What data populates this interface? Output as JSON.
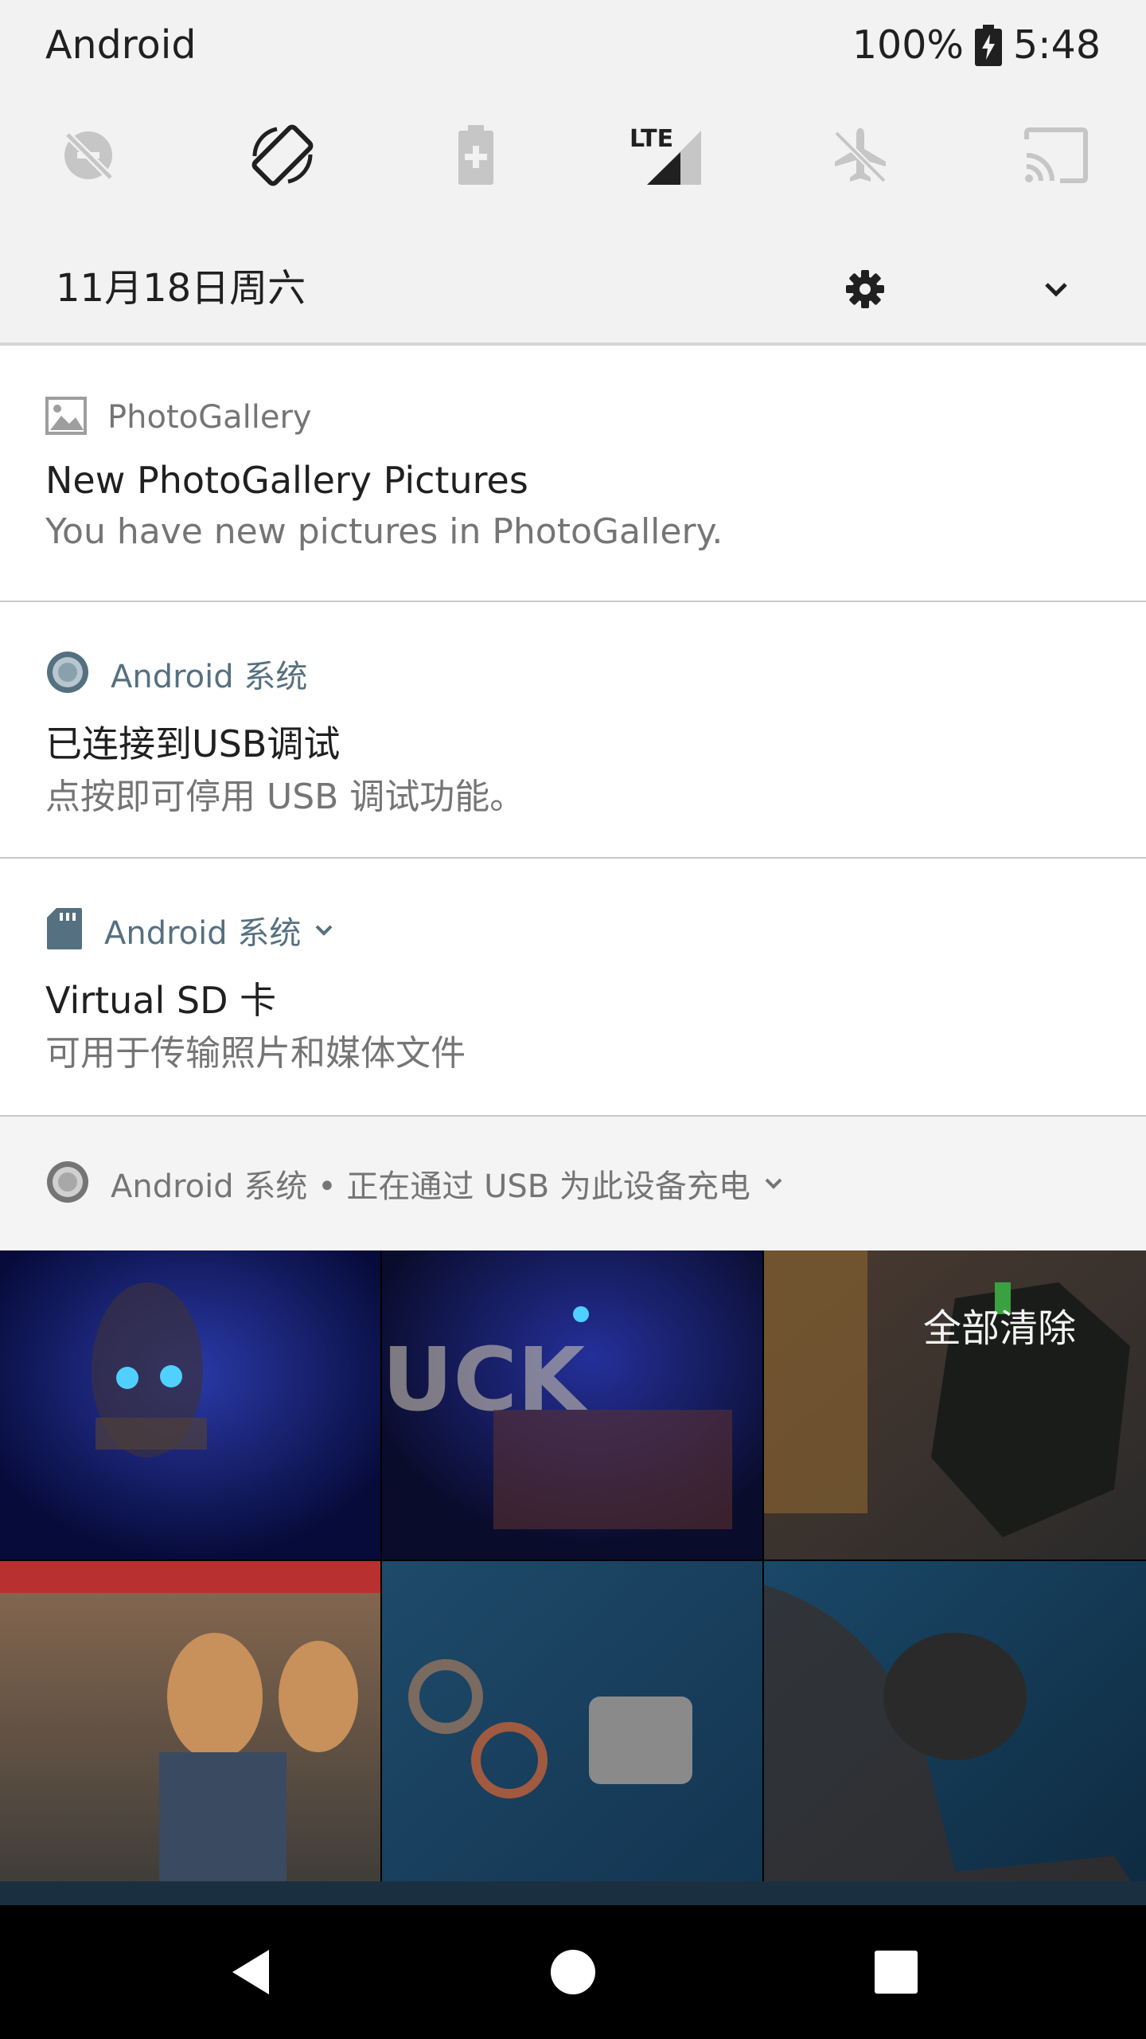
{
  "status_bar": {
    "carrier": "Android",
    "battery_percent": "100%",
    "time": "5:48",
    "battery_icon": "battery-charging-icon"
  },
  "quick_settings": {
    "tiles": [
      {
        "name": "data-saver-off-icon"
      },
      {
        "name": "auto-rotate-icon"
      },
      {
        "name": "battery-saver-icon"
      },
      {
        "name": "lte-signal-icon",
        "label": "LTE"
      },
      {
        "name": "airplane-mode-icon"
      },
      {
        "name": "cast-icon"
      }
    ]
  },
  "date_row": {
    "date": "11月18日周六",
    "settings_icon": "gear-icon",
    "expand_icon": "chevron-down-icon"
  },
  "notifications": [
    {
      "app": "PhotoGallery",
      "icon": "image-icon",
      "title": "New PhotoGallery Pictures",
      "text": "You have new pictures in PhotoGallery."
    },
    {
      "app": "Android 系统",
      "icon": "android-system-icon",
      "title": "已连接到USB调试",
      "text": "点按即可停用 USB 调试功能。"
    },
    {
      "app": "Android 系统",
      "icon": "sd-card-icon",
      "title": "Virtual SD 卡",
      "text": "可用于传输照片和媒体文件"
    }
  ],
  "collapsed_group": {
    "text": "Android 系统 • 正在通过 USB 为此设备充电",
    "icon": "android-system-icon"
  },
  "clear_all": "全部清除",
  "nav_bar": {
    "back": "back-icon",
    "home": "home-icon",
    "recents": "recents-icon"
  },
  "colors": {
    "shade_bg": "#f2f2f2",
    "card_bg": "#ffffff",
    "system_app_accent": "#557080",
    "secondary_text": "#757575"
  }
}
